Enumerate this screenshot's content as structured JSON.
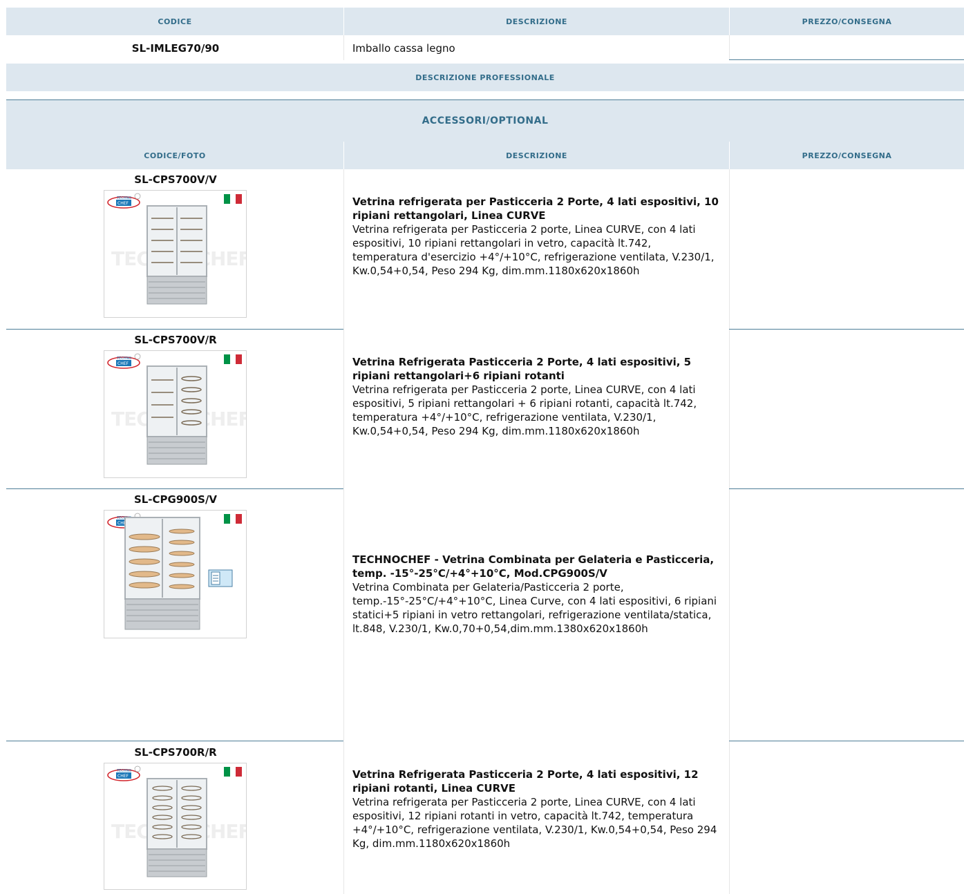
{
  "top_header": {
    "codice": "CODICE",
    "descrizione": "DESCRIZIONE",
    "prezzo": "PREZZO/CONSEGNA"
  },
  "main_item": {
    "code": "SL-IMLEG70/90",
    "description": "Imballo cassa legno"
  },
  "professional_header": "DESCRIZIONE PROFESSIONALE",
  "accessories_header": "ACCESSORI/OPTIONAL",
  "accessories_columns": {
    "codice_foto": "CODICE/FOTO",
    "descrizione": "DESCRIZIONE",
    "prezzo": "PREZZO/CONSEGNA"
  },
  "products": [
    {
      "code": "SL-CPS700V/V",
      "title": "Vetrina refrigerata per Pasticceria 2 Porte, 4 lati espositivi, 10 ripiani rettangolari, Linea CURVE",
      "text": "Vetrina refrigerata per Pasticceria 2 porte, Linea CURVE, con 4 lati espositivi, 10 ripiani rettangolari in vetro, capacità lt.742, temperatura d'esercizio +4°/+10°C, refrigerazione ventilata, V.230/1, Kw.0,54+0,54, Peso 294 Kg, dim.mm.1180x620x1860h"
    },
    {
      "code": "SL-CPS700V/R",
      "title": "Vetrina Refrigerata Pasticceria 2 Porte, 4 lati espositivi, 5 ripiani rettangolari+6 ripiani rotanti",
      "text": "Vetrina refrigerata per Pasticceria 2 porte, Linea CURVE, con 4 lati espositivi, 5 ripiani rettangolari + 6 ripiani rotanti, capacità lt.742, temperatura +4°/+10°C, refrigerazione ventilata, V.230/1, Kw.0,54+0,54, Peso 294 Kg, dim.mm.1180x620x1860h"
    },
    {
      "code": "SL-CPG900S/V",
      "title": "TECHNOCHEF - Vetrina Combinata per Gelateria e Pasticceria, temp. -15°-25°C/+4°+10°C, Mod.CPG900S/V",
      "text": "Vetrina Combinata per Gelateria/Pasticceria 2 porte, temp.-15°-25°C/+4°+10°C, Linea Curve, con 4 lati espositivi, 6 ripiani statici+5 ripiani in vetro rettangolari, refrigerazione ventilata/statica, lt.848, V.230/1, Kw.0,70+0,54,dim.mm.1380x620x1860h"
    },
    {
      "code": "SL-CPS700R/R",
      "title": "Vetrina Refrigerata Pasticceria 2 Porte, 4 lati espositivi, 12 ripiani rotanti, Linea CURVE",
      "text": "Vetrina refrigerata per Pasticceria 2 porte, Linea CURVE, con 4 lati espositivi, 12 ripiani rotanti in vetro, capacità lt.742, temperatura +4°/+10°C, refrigerazione ventilata, V.230/1, Kw.0,54+0,54, Peso 294 Kg, dim.mm.1180x620x1860h"
    }
  ],
  "logo_text": "TECHNO CHEF",
  "watermark": "TECHNOCHEF.IT",
  "colors": {
    "header_bg": "#dde7ef",
    "header_text": "#336d8a",
    "rule": "#4d7d97",
    "flag_green": "#009246",
    "flag_white": "#ffffff",
    "flag_red": "#ce2b37"
  }
}
